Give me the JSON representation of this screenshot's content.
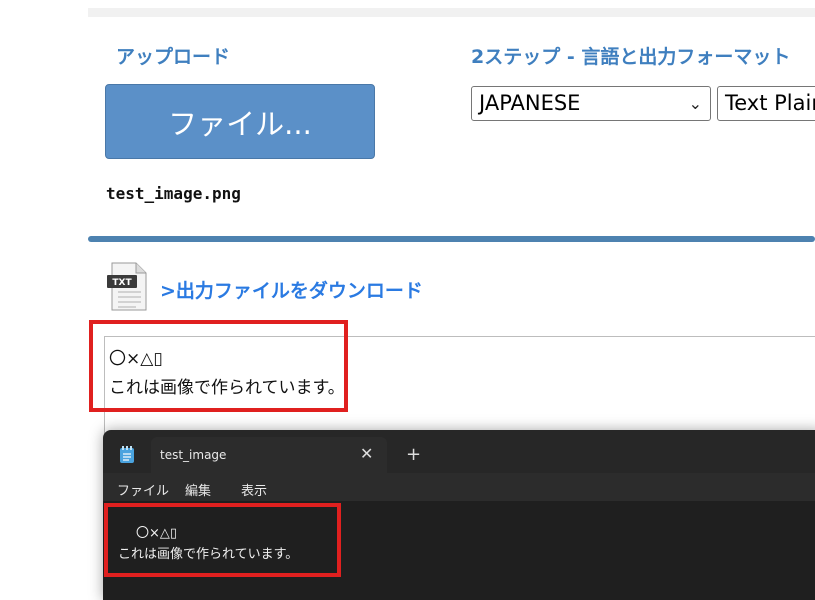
{
  "upload": {
    "heading": "アップロード",
    "button_label": "ファイル...",
    "filename": "test_image.png"
  },
  "step": {
    "heading": "2ステップ - 言語と出力フォーマット",
    "language_selected": "JAPANESE",
    "format_selected": "Text Plain"
  },
  "download": {
    "icon_label": "TXT",
    "link_text": ">出力ファイルをダウンロード"
  },
  "output": {
    "line1": "〇×△▯",
    "line2": "これは画像で作られています。"
  },
  "notepad": {
    "tab_title": "test_image",
    "close_glyph": "✕",
    "new_tab_glyph": "+",
    "menu": [
      "ファイル",
      "編集",
      "表示"
    ],
    "line1": "〇×△▯",
    "line2": "これは画像で作られています。"
  },
  "colors": {
    "accent": "#3f7fbf",
    "button": "#5b90c8",
    "link": "#2a7ae2",
    "highlight": "#e0201f",
    "notepad_bg": "#272727"
  }
}
